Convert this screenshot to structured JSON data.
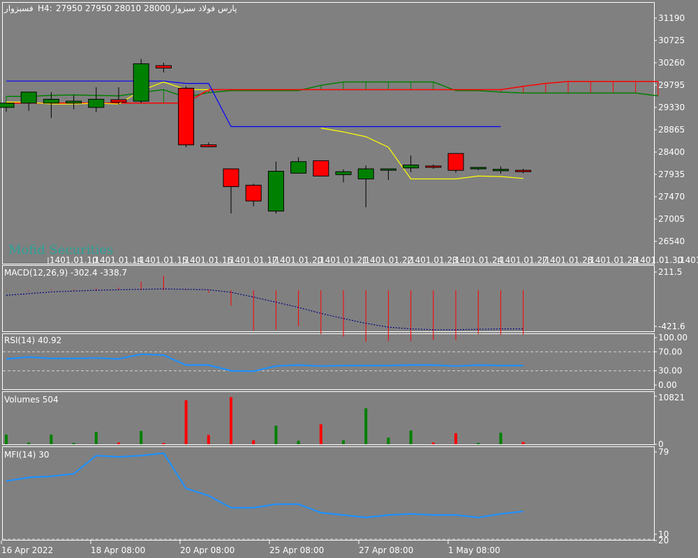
{
  "header": {
    "symbol": "فسبزوار",
    "timeframe": "H4:",
    "ohlc": "27950 27950 28010 28000",
    "name": "پارس فولاد سبزوار"
  },
  "watermark": "Mofid Securities",
  "colors": {
    "background": "#808080",
    "bull": "#008000",
    "bear": "#ff0000",
    "tenkan": "#ffff00",
    "kijun": "#0000ff",
    "senkou_a": "#008000",
    "senkou_b": "#ff0000",
    "macd_hist": "#ff0000",
    "macd_signal": "#000080",
    "rsi": "#1e90ff",
    "mfi": "#1e90ff",
    "grid_line": "#ffffff"
  },
  "main_axis": {
    "ticks": [
      "31190",
      "30725",
      "30260",
      "29795",
      "29330",
      "28865",
      "28400",
      "27935",
      "27470",
      "27005",
      "26540"
    ]
  },
  "main_date_strip": [
    "1401.01.10",
    "1401.01.14",
    "1401.01.15",
    "1401.01.16",
    "1401.01.17",
    "1401.01.20",
    "1401.01.21",
    "1401.01.22",
    "1401.01.23",
    "1401.01.24",
    "1401.01.27",
    "1401.01.28",
    "1401.01.29",
    "1401.01.30",
    "1401.0"
  ],
  "macd": {
    "label": "MACD(12,26,9) -302.4 -338.7",
    "ticks": [
      "211.5",
      "-421.6"
    ]
  },
  "rsi": {
    "label": "RSI(14) 40.92",
    "ticks": [
      "100.00",
      "70.00",
      "30.00",
      "0.00"
    ]
  },
  "volumes": {
    "label": "Volumes 504",
    "ticks": [
      "10821",
      "0"
    ]
  },
  "mfi": {
    "label": "MFI(14) 30",
    "ticks": [
      "79",
      "10",
      "20"
    ]
  },
  "time_axis": [
    "16 Apr 2022",
    "18 Apr 08:00",
    "20 Apr 08:00",
    "25 Apr 08:00",
    "27 Apr 08:00",
    "1 May 08:00"
  ],
  "chart_data": {
    "type": "candlestick",
    "price_range": [
      26540,
      31190
    ],
    "candles": [
      {
        "o": 29330,
        "h": 29420,
        "l": 29240,
        "c": 29420
      },
      {
        "o": 29420,
        "h": 29650,
        "l": 29260,
        "c": 29650
      },
      {
        "o": 29420,
        "h": 29650,
        "l": 29110,
        "c": 29500
      },
      {
        "o": 29420,
        "h": 29580,
        "l": 29290,
        "c": 29460
      },
      {
        "o": 29330,
        "h": 29750,
        "l": 29230,
        "c": 29500
      },
      {
        "o": 29490,
        "h": 29750,
        "l": 29390,
        "c": 29440
      },
      {
        "o": 29460,
        "h": 30340,
        "l": 29420,
        "c": 30240
      },
      {
        "o": 30200,
        "h": 30260,
        "l": 30060,
        "c": 30150
      },
      {
        "o": 29730,
        "h": 29770,
        "l": 28500,
        "c": 28550
      },
      {
        "o": 28550,
        "h": 28600,
        "l": 28500,
        "c": 28510
      },
      {
        "o": 28050,
        "h": 28050,
        "l": 27120,
        "c": 27680
      },
      {
        "o": 27710,
        "h": 27740,
        "l": 27270,
        "c": 27380
      },
      {
        "o": 27170,
        "h": 28200,
        "l": 27120,
        "c": 28000
      },
      {
        "o": 27960,
        "h": 28290,
        "l": 27960,
        "c": 28200
      },
      {
        "o": 28220,
        "h": 28220,
        "l": 27900,
        "c": 27900
      },
      {
        "o": 27930,
        "h": 28040,
        "l": 27770,
        "c": 27990
      },
      {
        "o": 27840,
        "h": 28120,
        "l": 27250,
        "c": 28050
      },
      {
        "o": 28040,
        "h": 28050,
        "l": 27820,
        "c": 28050
      },
      {
        "o": 28070,
        "h": 28330,
        "l": 27980,
        "c": 28130
      },
      {
        "o": 28110,
        "h": 28140,
        "l": 28050,
        "c": 28090
      },
      {
        "o": 28370,
        "h": 28370,
        "l": 27970,
        "c": 28020
      },
      {
        "o": 28050,
        "h": 28080,
        "l": 28020,
        "c": 28080
      },
      {
        "o": 28040,
        "h": 28100,
        "l": 27950,
        "c": 28040
      },
      {
        "o": 28020,
        "h": 28050,
        "l": 27960,
        "c": 28000
      }
    ],
    "ichimoku": {
      "tenkan": [
        29440,
        29440,
        29400,
        29400,
        29420,
        29400,
        29680,
        29860,
        29700,
        29700,
        null,
        null,
        null,
        null,
        28900,
        28820,
        28720,
        28500,
        27840,
        27840,
        27840,
        27900,
        27890,
        27850
      ],
      "kijun": [
        29880,
        29880,
        29880,
        29880,
        29880,
        29880,
        29880,
        29880,
        29830,
        29830,
        28930,
        28930,
        28930,
        28930,
        28930,
        28930,
        28930,
        28930,
        28930,
        28930,
        28930,
        28930,
        28930
      ],
      "senkou_a_x_range": [
        0,
        29
      ],
      "senkou_a": [
        29560,
        29560,
        29580,
        29590,
        29580,
        29570,
        29640,
        29700,
        29540,
        29640,
        29680,
        29680,
        29680,
        29680,
        29790,
        29860,
        29860,
        29860,
        29860,
        29860,
        29680,
        29680,
        29650,
        29630,
        29630,
        29630,
        29630,
        29630,
        29630,
        29570
      ],
      "senkou_b": [
        29420,
        29420,
        29420,
        29420,
        29420,
        29420,
        29420,
        29420,
        29420,
        29700,
        29700,
        29700,
        29700,
        29700,
        29700,
        29700,
        29700,
        29700,
        29700,
        29700,
        29700,
        29700,
        29700,
        29770,
        29830,
        29870,
        29870,
        29870,
        29870,
        29870
      ]
    },
    "macd_range": [
      -421.6,
      211.5
    ],
    "macd_hist": [
      -5,
      -10,
      10,
      10,
      20,
      30,
      100,
      170,
      10,
      -30,
      -180,
      -470,
      -460,
      -420,
      -510,
      -540,
      -600,
      -590,
      -590,
      -580,
      -580,
      -510,
      -520,
      -520
    ],
    "macd_signal": [
      -60,
      -40,
      -20,
      -10,
      0,
      5,
      10,
      15,
      10,
      5,
      -25,
      -80,
      -140,
      -200,
      -270,
      -330,
      -385,
      -430,
      -450,
      -460,
      -460,
      -455,
      -450,
      -450
    ],
    "rsi": [
      55,
      59,
      56,
      56,
      57,
      55,
      65,
      63,
      42,
      42,
      30,
      29,
      40,
      42,
      40,
      41,
      41,
      41,
      42,
      42,
      40,
      42,
      41,
      41
    ],
    "volume_max": 10821,
    "volume": [
      2200,
      400,
      2200,
      300,
      2800,
      400,
      3000,
      300,
      9900,
      2100,
      10600,
      900,
      4200,
      800,
      4500,
      900,
      8100,
      1500,
      3100,
      400,
      2500,
      300,
      2600,
      504
    ],
    "mfi_range": [
      10,
      79
    ],
    "mfi": [
      55,
      58,
      59,
      61,
      76,
      75,
      76,
      78,
      49,
      43,
      33,
      33,
      36,
      36,
      29,
      27,
      25,
      27,
      28,
      27,
      27,
      25,
      28,
      30
    ]
  }
}
